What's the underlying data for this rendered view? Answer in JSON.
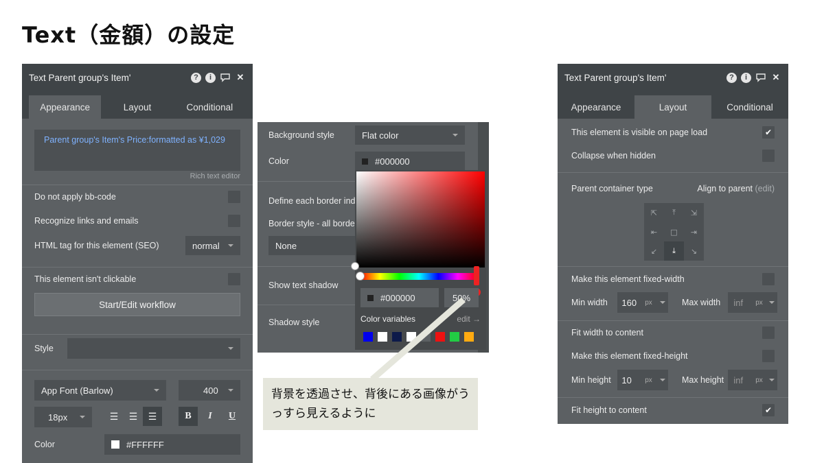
{
  "slide": {
    "title": "Text（金額）の設定",
    "callout": "背景を透過させ、背後にある画像がうっすら見えるように"
  },
  "left_panel": {
    "title": "Text Parent group's Item'",
    "tabs": [
      "Appearance",
      "Layout",
      "Conditional"
    ],
    "active_tab": "Appearance",
    "expression": "Parent group's Item's Price:formatted as ¥1,029",
    "rich_text_link": "Rich text editor",
    "no_bbcode_label": "Do not apply bb-code",
    "recognize_links_label": "Recognize links and emails",
    "html_tag_label": "HTML tag for this element (SEO)",
    "html_tag_value": "normal",
    "not_clickable_label": "This element isn't clickable",
    "workflow_button": "Start/Edit workflow",
    "style_label": "Style",
    "font_value": "App Font (Barlow)",
    "weight_value": "400",
    "size_value": "18px",
    "bold": "B",
    "italic": "I",
    "underline": "U",
    "color_label": "Color",
    "color_value": "#FFFFFF"
  },
  "middle_panel": {
    "bg_style_label": "Background style",
    "bg_style_value": "Flat color",
    "color_label": "Color",
    "color_value": "#000000",
    "border_each_label": "Define each border ind",
    "border_style_label": "Border style - all border",
    "border_style_value": "None",
    "text_shadow_label": "Show text shadow",
    "shadow_style_label": "Shadow style"
  },
  "color_picker": {
    "hex_value": "#000000",
    "opacity": "50%",
    "variables_label": "Color variables",
    "edit_link": "edit →",
    "swatches": [
      "#0000ee",
      "#ffffff",
      "#0d1a4a",
      "#ffffff",
      "#5c6063",
      "#ee1111",
      "#22cc44",
      "#ffaa11"
    ]
  },
  "right_panel": {
    "title": "Text Parent group's Item'",
    "tabs": [
      "Appearance",
      "Layout",
      "Conditional"
    ],
    "active_tab": "Layout",
    "visible_label": "This element is visible on page load",
    "collapse_label": "Collapse when hidden",
    "parent_type_label": "Parent container type",
    "parent_type_value": "Align to parent",
    "parent_type_edit": "(edit)",
    "fixed_width_label": "Make this element fixed-width",
    "min_width_label": "Min width",
    "min_width_value": "160",
    "max_width_label": "Max width",
    "max_width_value": "inf",
    "unit_px": "px",
    "fit_width_label": "Fit width to content",
    "fixed_height_label": "Make this element fixed-height",
    "min_height_label": "Min height",
    "min_height_value": "10",
    "max_height_label": "Max height",
    "max_height_value": "inf",
    "fit_height_label": "Fit height to content"
  },
  "colors": {
    "panel_bg": "#5c6063",
    "panel_header": "#3f4447",
    "accent_link": "#7fb2ff",
    "marker_red": "#ee2222"
  }
}
